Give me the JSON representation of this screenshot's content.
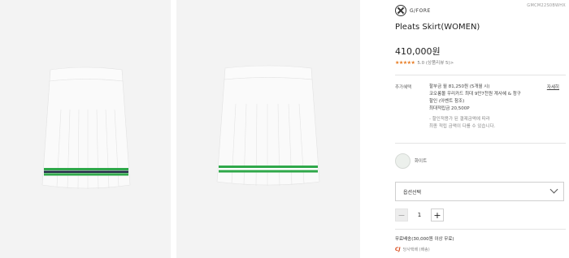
{
  "brand": {
    "name": "G/FORE",
    "logo_icon": "gfore-cross-logo"
  },
  "product": {
    "code": "GMCM22S0BWHX",
    "title": "Pleats Skirt(WOMEN)",
    "price": "410,000원",
    "rating_stars": "★★★★★",
    "rating_text": "5.0 (상품리뷰 5)>"
  },
  "images": [
    {
      "description_icon": "pleated-skirt-front",
      "stripe_colors": [
        "#2fa84a",
        "#1f2b44",
        "#2fa84a"
      ]
    },
    {
      "description_icon": "pleated-skirt-back",
      "stripe_colors": [
        "#2fa84a",
        "#ffffff",
        "#2fa84a"
      ]
    }
  ],
  "benefit": {
    "label": "추가혜택",
    "lines": [
      "할부금 월 81,250원 (5개월 시)",
      "코오롱몰 우리카드 최대 9만7천원 계사혜 & 청구",
      "할인 (아벤트 참조)",
      "최대적립금 20,500P",
      "- 할인적용가 된 결제금액에 따라",
      "최종 적립 금액이 다를 수 있습니다."
    ],
    "link": "자세히"
  },
  "color_option": {
    "label": "화이트",
    "swatch_color": "#ecf0ec"
  },
  "option_select": {
    "label": "옵션선택"
  },
  "quantity": {
    "minus": "−",
    "value": "1",
    "plus": "+"
  },
  "shipping": {
    "text": "무료배송(30,000원 이상 무료)",
    "courier_logo": "CJ",
    "courier_text": "당사택배 (배송)"
  },
  "colors": {
    "accent_green": "#2fa84a",
    "navy": "#1f2b44",
    "star": "#e8791e"
  }
}
